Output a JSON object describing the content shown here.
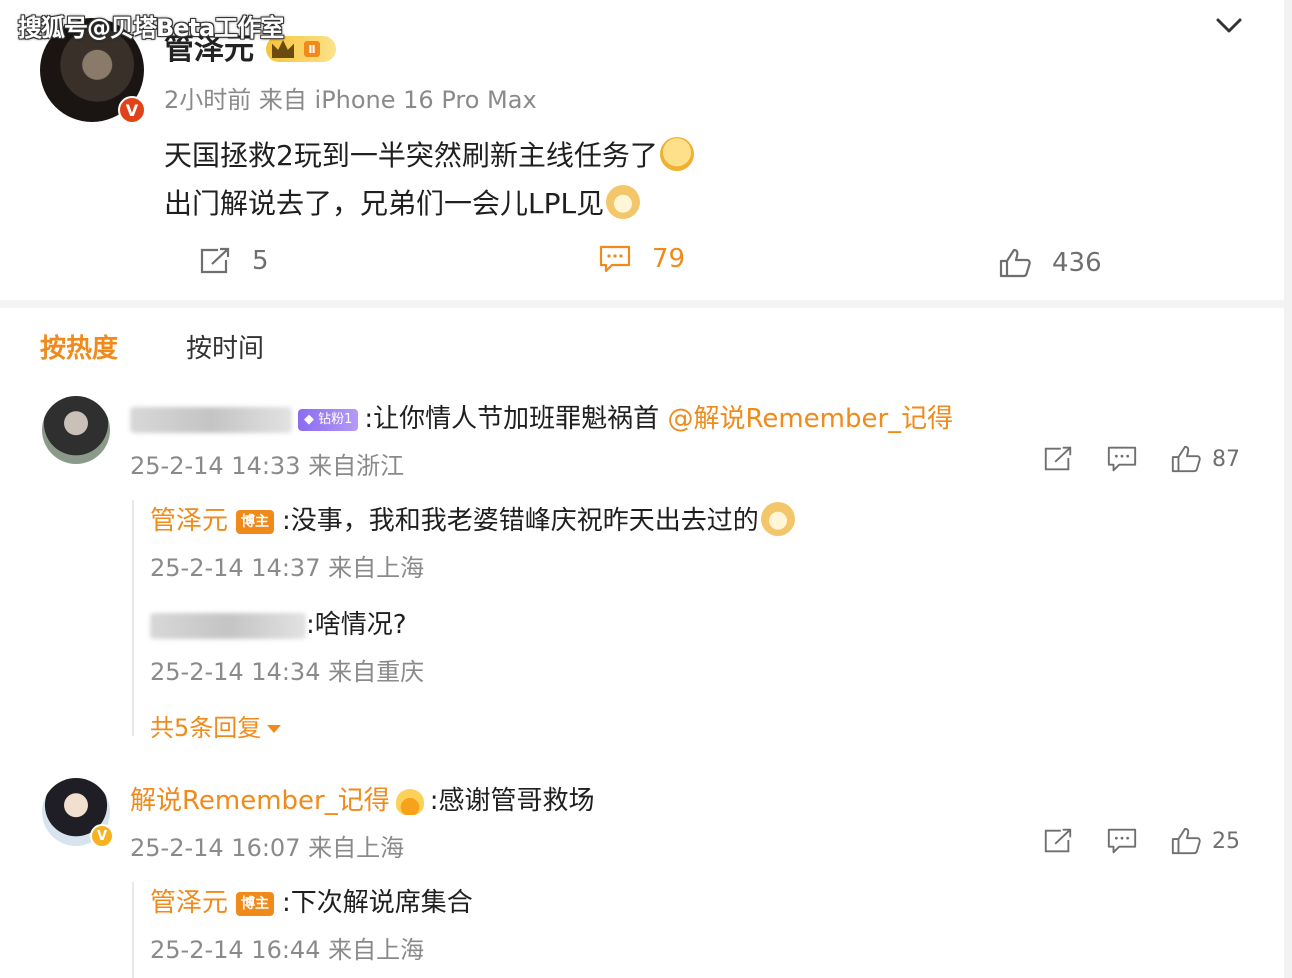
{
  "watermark": "搜狐号@贝塔Beta工作室",
  "post": {
    "author": "管泽元",
    "verified_badge": "V",
    "level_badge": "Ⅱ",
    "meta": "2小时前  来自 iPhone 16 Pro Max",
    "line1": "天国拯救2玩到一半突然刷新主线任务了",
    "line2": "出门解说去了，兄弟们一会儿LPL见",
    "reposts": "5",
    "comments": "79",
    "likes": "436"
  },
  "tabs": {
    "hot": "按热度",
    "time": "按时间"
  },
  "comments": [
    {
      "fan_badge": "钻粉1",
      "text": ":让你情人节加班罪魁祸首 ",
      "mention": "@解说Remember_记得",
      "meta": "25-2-14 14:33 来自浙江",
      "likes": "87",
      "replies": [
        {
          "author": "管泽元",
          "badge": "博主",
          "text": ":没事，我和我老婆错峰庆祝昨天出去过的",
          "meta": "25-2-14 14:37 来自上海"
        },
        {
          "author": "",
          "text": ":啥情况?",
          "meta": "25-2-14 14:34 来自重庆"
        }
      ],
      "more": "共5条回复"
    },
    {
      "author": "解说Remember_记得",
      "verified_badge": "V",
      "text": ":感谢管哥救场",
      "meta": "25-2-14 16:07 来自上海",
      "likes": "25",
      "replies": [
        {
          "author": "管泽元",
          "badge": "博主",
          "text": ":下次解说席集合",
          "meta": "25-2-14 16:44 来自上海"
        }
      ]
    }
  ],
  "colors": {
    "accent": "#f08a1a",
    "meta": "#8a8a8a",
    "fan_badge": "#8b6cf0"
  },
  "icons": [
    "chevron-down-icon",
    "repost-icon",
    "comment-icon",
    "like-icon",
    "crown-icon",
    "emoji-icon"
  ]
}
